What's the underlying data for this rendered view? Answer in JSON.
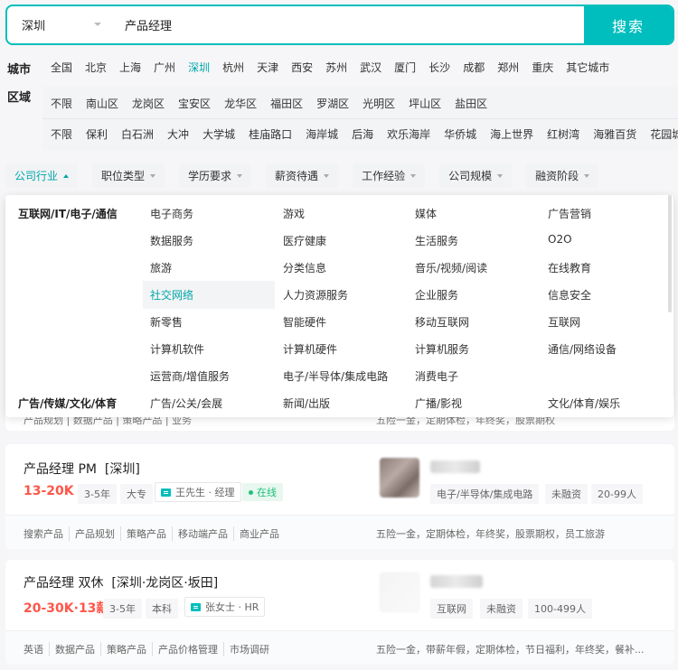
{
  "search": {
    "city": "深圳",
    "query": "产品经理",
    "button": "搜索"
  },
  "city_filter": {
    "label": "城市",
    "items": [
      "全国",
      "北京",
      "上海",
      "广州",
      "深圳",
      "杭州",
      "天津",
      "西安",
      "苏州",
      "武汉",
      "厦门",
      "长沙",
      "成都",
      "郑州",
      "重庆",
      "其它城市"
    ],
    "active": "深圳"
  },
  "district_filter": {
    "label": "区域",
    "row1": [
      "不限",
      "南山区",
      "龙岗区",
      "宝安区",
      "龙华区",
      "福田区",
      "罗湖区",
      "光明区",
      "坪山区",
      "盐田区"
    ],
    "row2": [
      "不限",
      "保利",
      "白石洲",
      "大冲",
      "大学城",
      "桂庙路口",
      "海岸城",
      "后海",
      "欢乐海岸",
      "华侨城",
      "海上世界",
      "红树湾",
      "海雅百货",
      "花园城"
    ]
  },
  "filters": [
    "公司行业",
    "职位类型",
    "学历要求",
    "薪资待遇",
    "工作经验",
    "公司规模",
    "融资阶段"
  ],
  "industry_panel": {
    "categories": [
      "互联网/IT/电子/通信",
      "广告/传媒/文化/体育"
    ],
    "col1": [
      "电子商务",
      "数据服务",
      "旅游",
      "社交网络",
      "新零售",
      "计算机软件",
      "运营商/增值服务",
      "广告/公关/会展"
    ],
    "col2": [
      "游戏",
      "医疗健康",
      "分类信息",
      "人力资源服务",
      "智能硬件",
      "计算机硬件",
      "电子/半导体/集成电路",
      "新闻/出版"
    ],
    "col3": [
      "媒体",
      "生活服务",
      "音乐/视频/阅读",
      "企业服务",
      "移动互联网",
      "计算机服务",
      "消费电子",
      "广播/影视"
    ],
    "col4": [
      "广告营销",
      "O2O",
      "在线教育",
      "信息安全",
      "互联网",
      "通信/网络设备",
      "",
      "文化/体育/娱乐"
    ],
    "highlighted": "社交网络"
  },
  "partial_card": {
    "left": "产品规划 | 数据产品 | 策略产品 | 业务",
    "right": "五险一金，定期体检，年终奖，股票期权"
  },
  "jobs": [
    {
      "title": "产品经理 PM",
      "location": "[深圳]",
      "salary": "13-20K",
      "experience": "3-5年",
      "education": "大专",
      "recruiter": "王先生 · 经理",
      "online": "在线",
      "company_tags": [
        "电子/半导体/集成电路",
        "未融资",
        "20-99人"
      ],
      "skills": [
        "搜索产品",
        "产品规划",
        "策略产品",
        "移动端产品",
        "商业产品"
      ],
      "welfare": "五险一金，定期体检，年终奖，股票期权，员工旅游"
    },
    {
      "title": "产品经理 双休",
      "location": "[深圳·龙岗区·坂田]",
      "salary": "20-30K·13薪",
      "experience": "3-5年",
      "education": "本科",
      "recruiter": "张女士 · HR",
      "company_tags": [
        "互联网",
        "未融资",
        "100-499人"
      ],
      "skills": [
        "英语",
        "数据产品",
        "策略产品",
        "产品价格管理",
        "市场调研"
      ],
      "welfare": "五险一金，带薪年假，定期体检，节日福利，年终奖，餐补..."
    }
  ],
  "colors": {
    "accent": "#00bebd",
    "salary": "#fe574a",
    "online": "#1ec07b"
  }
}
